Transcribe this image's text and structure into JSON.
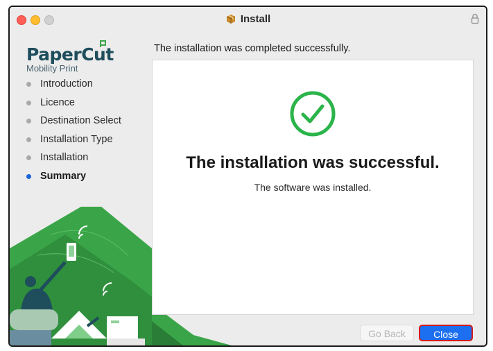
{
  "window": {
    "title": "Install",
    "title_icon": "package-icon",
    "lock_icon": "lock-icon"
  },
  "sidebar": {
    "logo": {
      "name": "PaperCut",
      "subtitle": "Mobility Print"
    },
    "steps": [
      {
        "label": "Introduction",
        "active": false
      },
      {
        "label": "Licence",
        "active": false
      },
      {
        "label": "Destination Select",
        "active": false
      },
      {
        "label": "Installation Type",
        "active": false
      },
      {
        "label": "Installation",
        "active": false
      },
      {
        "label": "Summary",
        "active": true
      }
    ]
  },
  "main": {
    "headline": "The installation was completed successfully.",
    "success_title": "The installation was successful.",
    "success_detail": "The software was installed.",
    "success_icon": "checkmark-circle-icon"
  },
  "buttons": {
    "back_label": "Go Back",
    "close_label": "Close"
  },
  "colors": {
    "accent": "#1c6ff0",
    "success": "#2bb44a",
    "brand_green": "#3aa548",
    "brand_dark": "#1e4d5c",
    "highlight": "#d51a1a"
  }
}
